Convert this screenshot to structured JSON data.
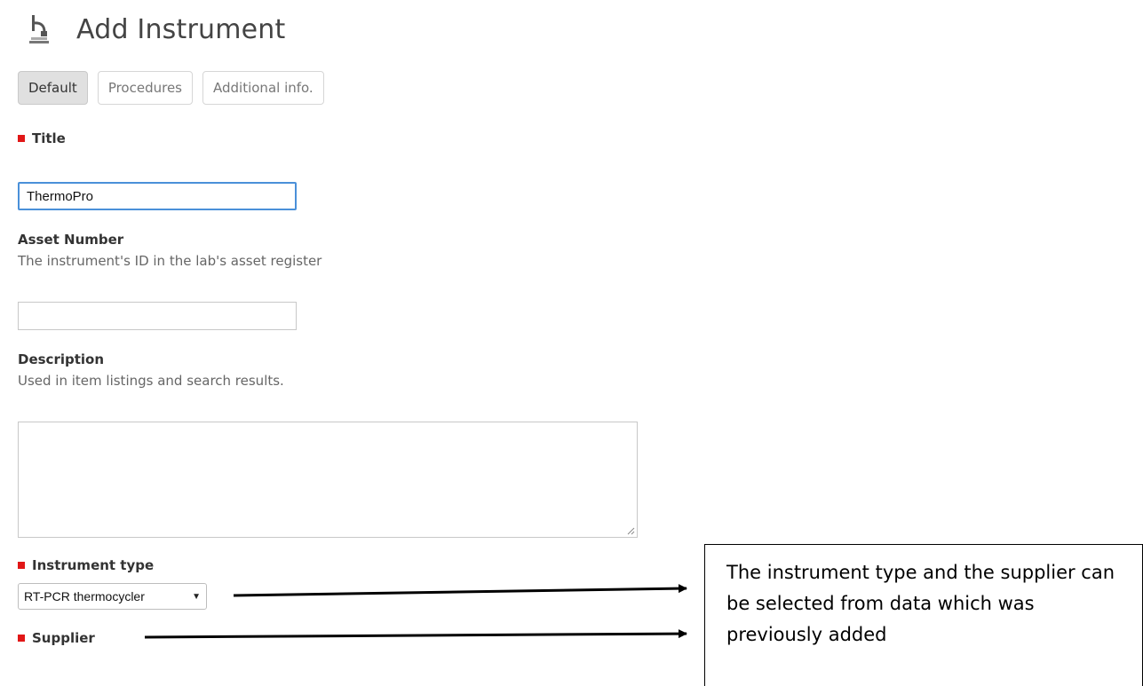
{
  "header": {
    "title": "Add Instrument",
    "icon": "microscope-icon"
  },
  "tabs": [
    {
      "label": "Default",
      "active": true
    },
    {
      "label": "Procedures",
      "active": false
    },
    {
      "label": "Additional info.",
      "active": false
    }
  ],
  "form": {
    "title": {
      "label": "Title",
      "required": true,
      "value": "ThermoPro"
    },
    "asset_number": {
      "label": "Asset Number",
      "help": "The instrument's ID in the lab's asset register",
      "value": ""
    },
    "description": {
      "label": "Description",
      "help": "Used in item listings and search results.",
      "value": ""
    },
    "instrument_type": {
      "label": "Instrument type",
      "required": true,
      "selected": "RT-PCR thermocycler"
    },
    "supplier": {
      "label": "Supplier",
      "required": true
    }
  },
  "annotation": {
    "text": "The instrument type and the supplier can be selected from data which was previously added"
  },
  "colors": {
    "required_marker": "#e11717",
    "focus_border": "#4a90d9",
    "active_tab_bg": "#e0e0e0"
  }
}
